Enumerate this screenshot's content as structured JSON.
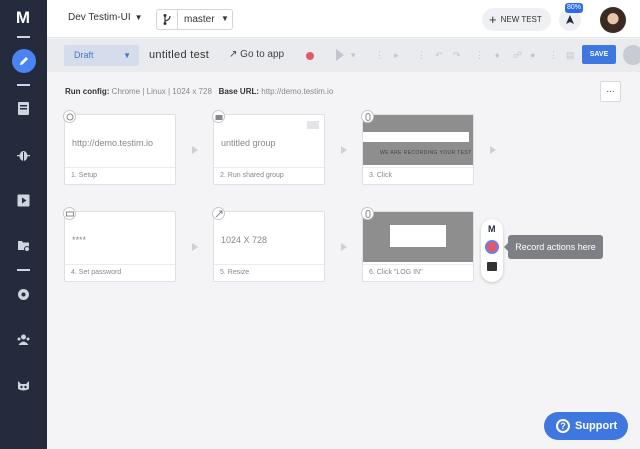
{
  "sidebar": {
    "logo": "M"
  },
  "topbar": {
    "project": "Dev Testim-UI",
    "branch": "master",
    "new_test": "NEW TEST",
    "progress_badge": "80%"
  },
  "toolbar": {
    "status": "Draft",
    "test_name": "untitled test",
    "go_to_app": "Go to app",
    "save": "SAVE"
  },
  "config": {
    "run_config_label": "Run config:",
    "run_config_value": "Chrome | Linux | 1024 x 728",
    "base_url_label": "Base URL:",
    "base_url_value": "http://demo.testim.io",
    "more": "..."
  },
  "steps": [
    {
      "text": "http://demo.testim.io",
      "label": "1. Setup"
    },
    {
      "text": "untitled group",
      "label": "2. Run shared group"
    },
    {
      "label": "3. Click",
      "preview_text": "WE ARE RECORDING YOUR TEST"
    },
    {
      "text": "****",
      "label": "4. Set password"
    },
    {
      "text": "1024 X 728",
      "label": "5. Resize"
    },
    {
      "label": "6. Click \"LOG IN\""
    }
  ],
  "record": {
    "logo": "M",
    "tooltip": "Record actions here"
  },
  "support": {
    "label": "Support",
    "icon": "?"
  },
  "colors": {
    "accent": "#3f77e0",
    "sidebar": "#232b3d",
    "record": "#e05a6a"
  }
}
